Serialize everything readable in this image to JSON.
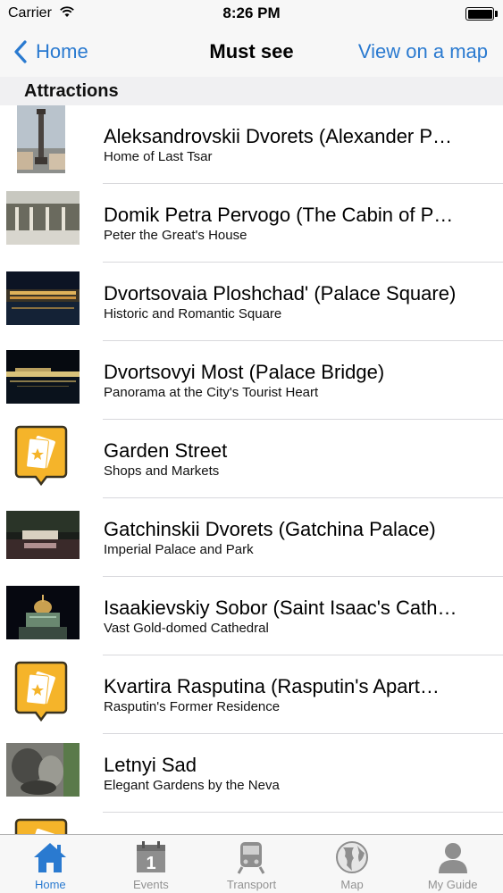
{
  "status_bar": {
    "carrier": "Carrier",
    "time": "8:26 PM"
  },
  "nav": {
    "back_label": "Home",
    "title": "Must see",
    "right_label": "View on a map"
  },
  "section": {
    "title": "Attractions"
  },
  "list": [
    {
      "title": "Aleksandrovskii Dvorets (Alexander P…",
      "subtitle": "Home of Last Tsar",
      "thumb": "column"
    },
    {
      "title": "Domik Petra Pervogo (The Cabin of P…",
      "subtitle": "Peter the Great's House",
      "thumb": "cabin"
    },
    {
      "title": "Dvortsovaia Ploshchad' (Palace Square)",
      "subtitle": "Historic and Romantic Square",
      "thumb": "night-palace"
    },
    {
      "title": "Dvortsovyi Most (Palace Bridge)",
      "subtitle": "Panorama at the City's Tourist Heart",
      "thumb": "night-bridge"
    },
    {
      "title": "Garden Street",
      "subtitle": "Shops and Markets",
      "thumb": "ticket-icon"
    },
    {
      "title": "Gatchinskii Dvorets (Gatchina Palace)",
      "subtitle": "Imperial Palace and Park",
      "thumb": "gatchina"
    },
    {
      "title": "Isaakievskiy Sobor (Saint Isaac's Cath…",
      "subtitle": "Vast Gold-domed Cathedral",
      "thumb": "cathedral"
    },
    {
      "title": "Kvartira Rasputina (Rasputin's Apart…",
      "subtitle": "Rasputin's Former Residence",
      "thumb": "ticket-icon"
    },
    {
      "title": "Letnyi Sad",
      "subtitle": "Elegant Gardens by the Neva",
      "thumb": "garden"
    },
    {
      "title": "",
      "subtitle": "",
      "thumb": "ticket-icon"
    }
  ],
  "tabs": [
    {
      "label": "Home",
      "icon": "home-icon",
      "active": true
    },
    {
      "label": "Events",
      "icon": "calendar-icon",
      "active": false
    },
    {
      "label": "Transport",
      "icon": "train-icon",
      "active": false
    },
    {
      "label": "Map",
      "icon": "globe-icon",
      "active": false
    },
    {
      "label": "My Guide",
      "icon": "person-icon",
      "active": false
    }
  ],
  "colors": {
    "accent": "#2a7ad0",
    "ticket_orange": "#f5b42a",
    "inactive_tab": "#929292"
  }
}
